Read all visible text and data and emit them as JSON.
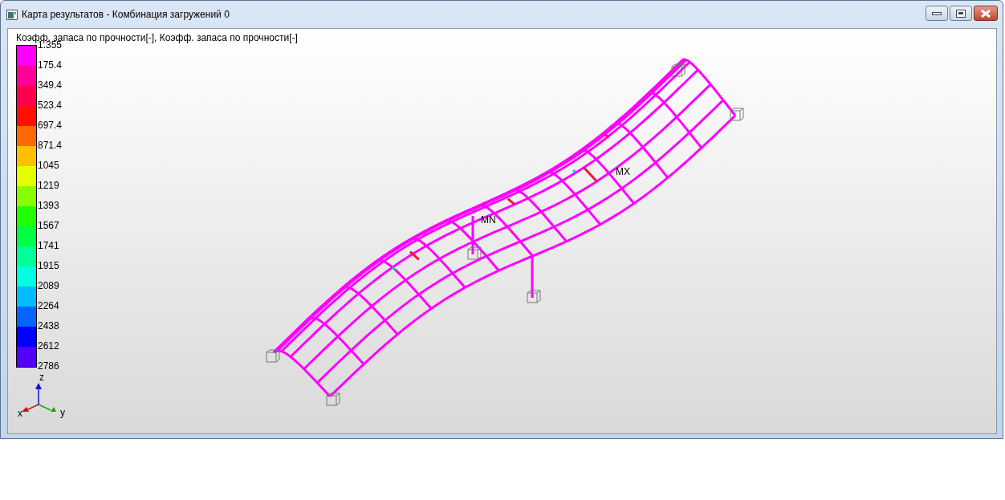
{
  "window": {
    "title": "Карта результатов - Комбинация загружений 0"
  },
  "legend": {
    "title": "Коэфф. запаса по прочности[-], Коэфф. запаса по прочности[-]",
    "labels": [
      "1.355",
      "175.4",
      "349.4",
      "523.4",
      "697.4",
      "871.4",
      "1045",
      "1219",
      "1393",
      "1567",
      "1741",
      "1915",
      "2089",
      "2264",
      "2438",
      "2612",
      "2786"
    ],
    "bands": [
      {
        "color": "#ff00ff"
      },
      {
        "color": "#ff0099"
      },
      {
        "color": "#ff0050"
      },
      {
        "color": "#ff1000"
      },
      {
        "color": "#ff6a00"
      },
      {
        "color": "#ffc000"
      },
      {
        "color": "#e4ff00"
      },
      {
        "color": "#88ff00"
      },
      {
        "color": "#22ff00"
      },
      {
        "color": "#00ff44"
      },
      {
        "color": "#00ff99"
      },
      {
        "color": "#00ffe0"
      },
      {
        "color": "#00bbff"
      },
      {
        "color": "#0066ff"
      },
      {
        "color": "#0000ff"
      },
      {
        "color": "#5500ff"
      }
    ]
  },
  "model": {
    "min_label": "MN",
    "max_label": "MX"
  },
  "axes": {
    "x": "x",
    "y": "y",
    "z": "z"
  }
}
